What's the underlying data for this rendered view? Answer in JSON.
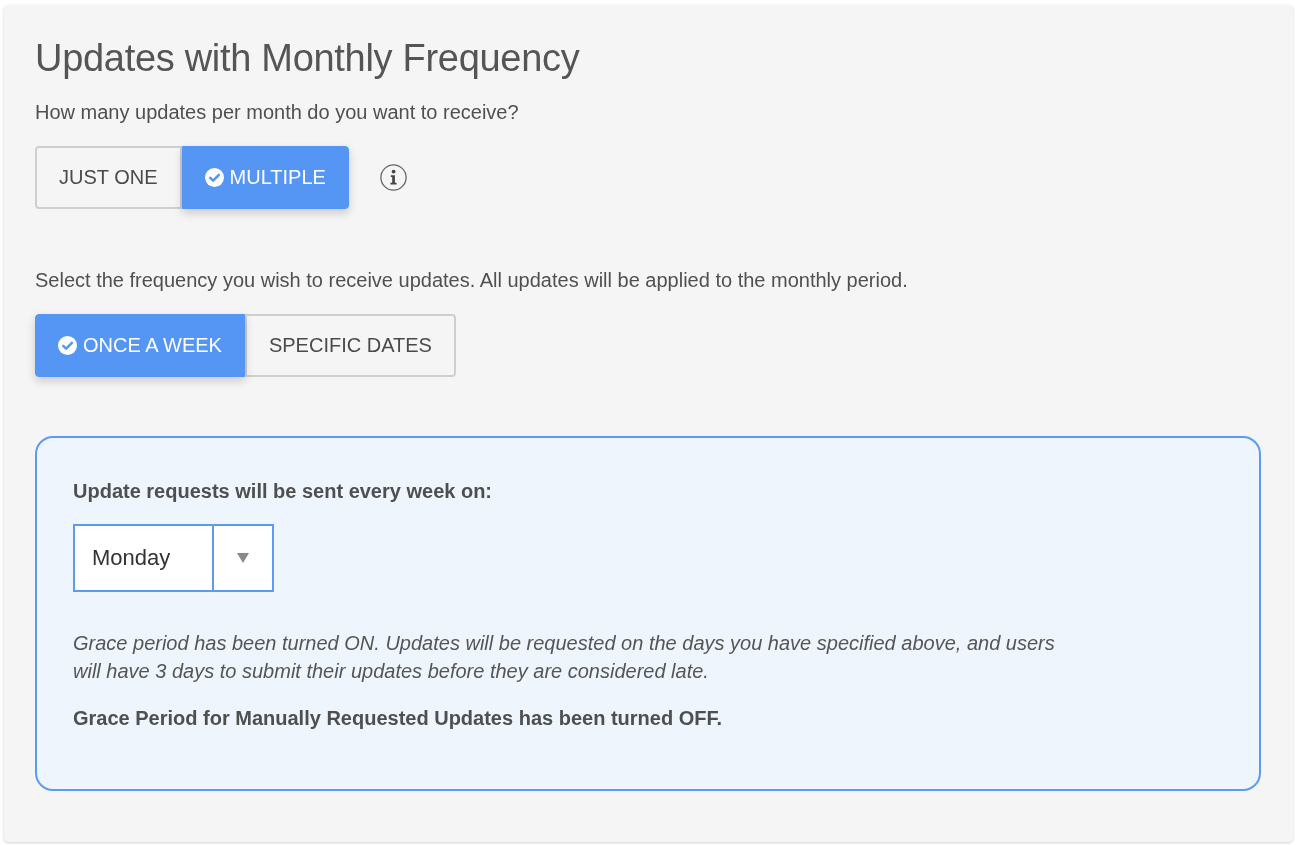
{
  "title": "Updates with Monthly Frequency",
  "count_question": {
    "label": "How many updates per month do you want to receive?",
    "options": [
      {
        "label": "JUST ONE",
        "selected": false
      },
      {
        "label": "MULTIPLE",
        "selected": true
      }
    ]
  },
  "frequency_question": {
    "label": "Select the frequency you wish to receive updates. All updates will be applied to the monthly period.",
    "options": [
      {
        "label": "ONCE A WEEK",
        "selected": true
      },
      {
        "label": "SPECIFIC DATES",
        "selected": false
      }
    ]
  },
  "weekly_panel": {
    "label": "Update requests will be sent every week on:",
    "day_select": {
      "value": "Monday"
    },
    "grace_note": "Grace period has been turned ON. Updates will be requested on the days you have specified above, and users will have 3 days to submit their updates before they are considered late.",
    "manual_note": "Grace Period for Manually Requested Updates has been turned OFF."
  }
}
